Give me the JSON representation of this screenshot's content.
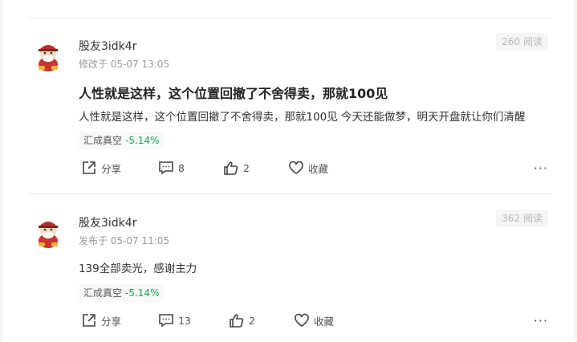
{
  "posts": [
    {
      "username": "股友3idk4r",
      "meta": "修改于 05-07 13:05",
      "reads": "260 阅读",
      "title": "人性就是这样，这个位置回撤了不舍得卖，那就100见",
      "body": "人性就是这样，这个位置回撤了不舍得卖，那就100见 今天还能做梦，明天开盘就让你们清醒",
      "tag": {
        "name": "汇成真空",
        "change": "-5.14%"
      },
      "actions": {
        "share": "分享",
        "comments": "8",
        "likes": "2",
        "collect": "收藏"
      },
      "more": "···"
    },
    {
      "username": "股友3idk4r",
      "meta": "发布于 05-07 11:05",
      "reads": "362 阅读",
      "body": "139全部卖光，感谢主力",
      "tag": {
        "name": "汇成真空",
        "change": "-5.14%"
      },
      "actions": {
        "share": "分享",
        "comments": "13",
        "likes": "2",
        "collect": "收藏"
      },
      "more": "···"
    }
  ],
  "colors": {
    "down": "#17a54a",
    "reads_bg": "#f5f5f5"
  }
}
